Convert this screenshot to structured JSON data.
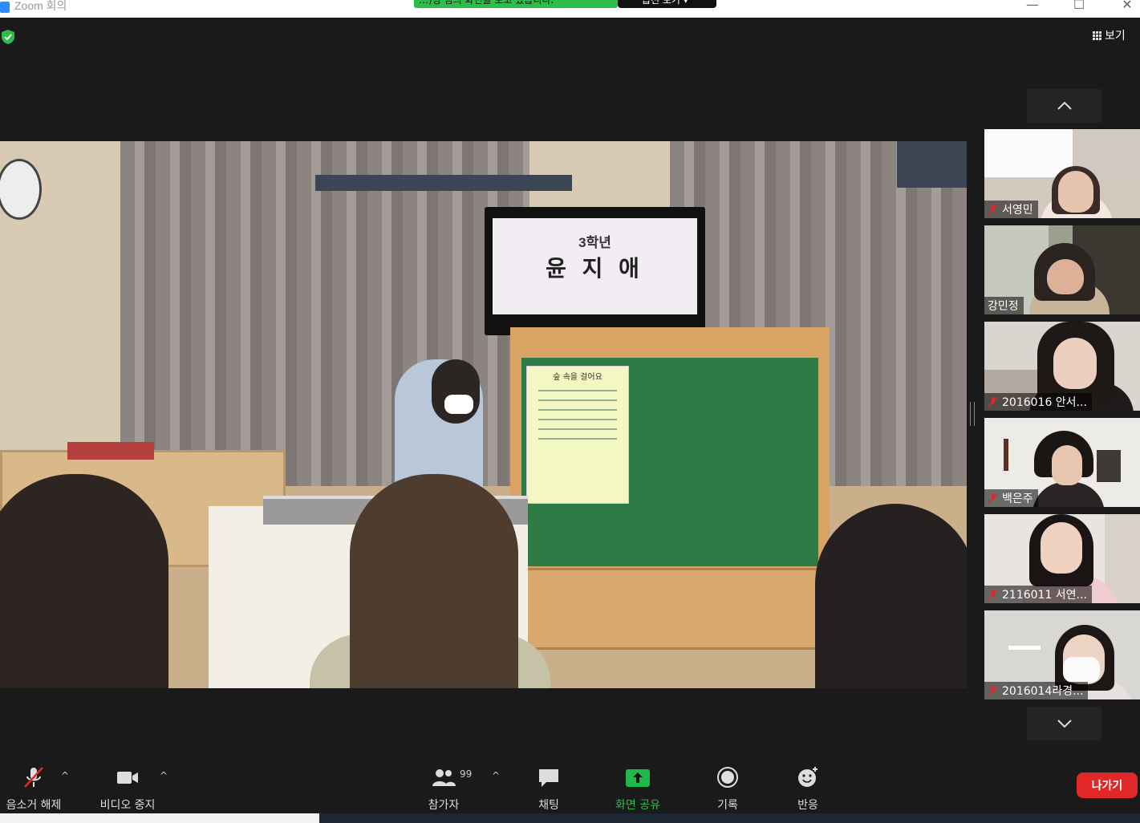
{
  "window": {
    "title": "Zoom 회의",
    "minimize": "—",
    "maximize": "☐",
    "close": "✕"
  },
  "share_banner": {
    "text": "…)명 님의 화면을 보고 있습니다.",
    "options": "옵션 보기 ▾"
  },
  "view_button": {
    "label": "보기"
  },
  "slide": {
    "line1": "3학년",
    "line2": "윤 지 애"
  },
  "poster": {
    "title": "숲 속을 걸어요"
  },
  "thumb_nav": {
    "up": "▲",
    "down": "▼"
  },
  "participants": [
    {
      "name": "서영민",
      "muted": true
    },
    {
      "name": "강민정",
      "muted": false
    },
    {
      "name": "2016016 안서...",
      "muted": true
    },
    {
      "name": "백은주",
      "muted": true
    },
    {
      "name": "2116011 서연...",
      "muted": true
    },
    {
      "name": "2016014라경...",
      "muted": true
    }
  ],
  "toolbar": {
    "unmute": "음소거 해제",
    "stop_video": "비디오 중지",
    "participants": "참가자",
    "participants_count": "99",
    "chat": "채팅",
    "share_screen": "화면 공유",
    "record": "기록",
    "reactions": "반응",
    "leave": "나가기"
  },
  "colors": {
    "accent_green": "#2ebd4a",
    "leave_red": "#e02828",
    "share_icon": "#1fb84a"
  }
}
